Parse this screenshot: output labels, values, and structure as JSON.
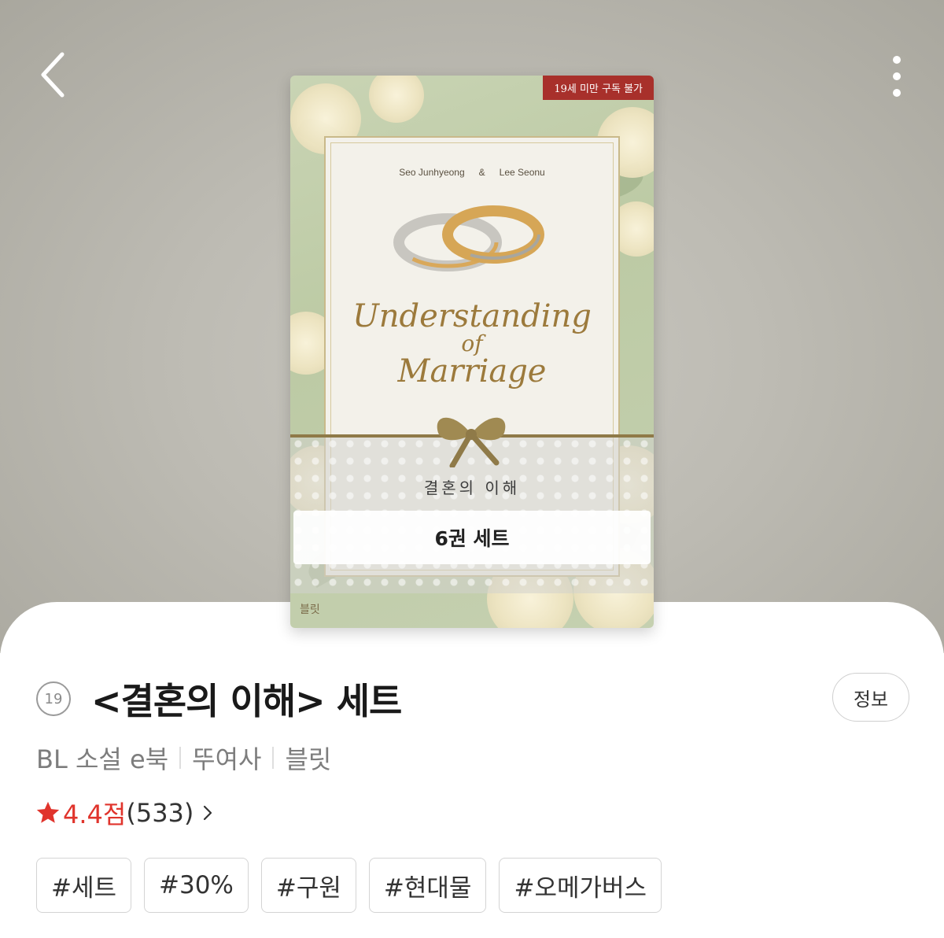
{
  "header": {
    "back_icon": "chevron-left-icon",
    "more_icon": "more-vertical-icon"
  },
  "cover": {
    "age_badge": "19세 미만 구독 불가",
    "author_left": "Seo Junhyeong",
    "ampersand": "&",
    "author_right": "Lee Seonu",
    "script_line1": "Understanding",
    "script_line2": "of",
    "script_line3": "Marriage",
    "kor_title": "결혼의 이해",
    "set_label": "6권 세트",
    "publisher_logo": "블릿"
  },
  "details": {
    "age_rating": "19",
    "title": "<결혼의 이해> 세트",
    "info_button": "정보",
    "category": "BL 소설 e북",
    "author": "뚜여사",
    "publisher": "블릿",
    "rating": "4.4점",
    "rating_count": "(533)",
    "tags": [
      "#세트",
      "#30%",
      "#구원",
      "#현대물",
      "#오메가버스"
    ]
  },
  "colors": {
    "rating_red": "#e0342c",
    "age_badge_bg": "#a8302b",
    "hero_bg": "#bdbbb3"
  }
}
